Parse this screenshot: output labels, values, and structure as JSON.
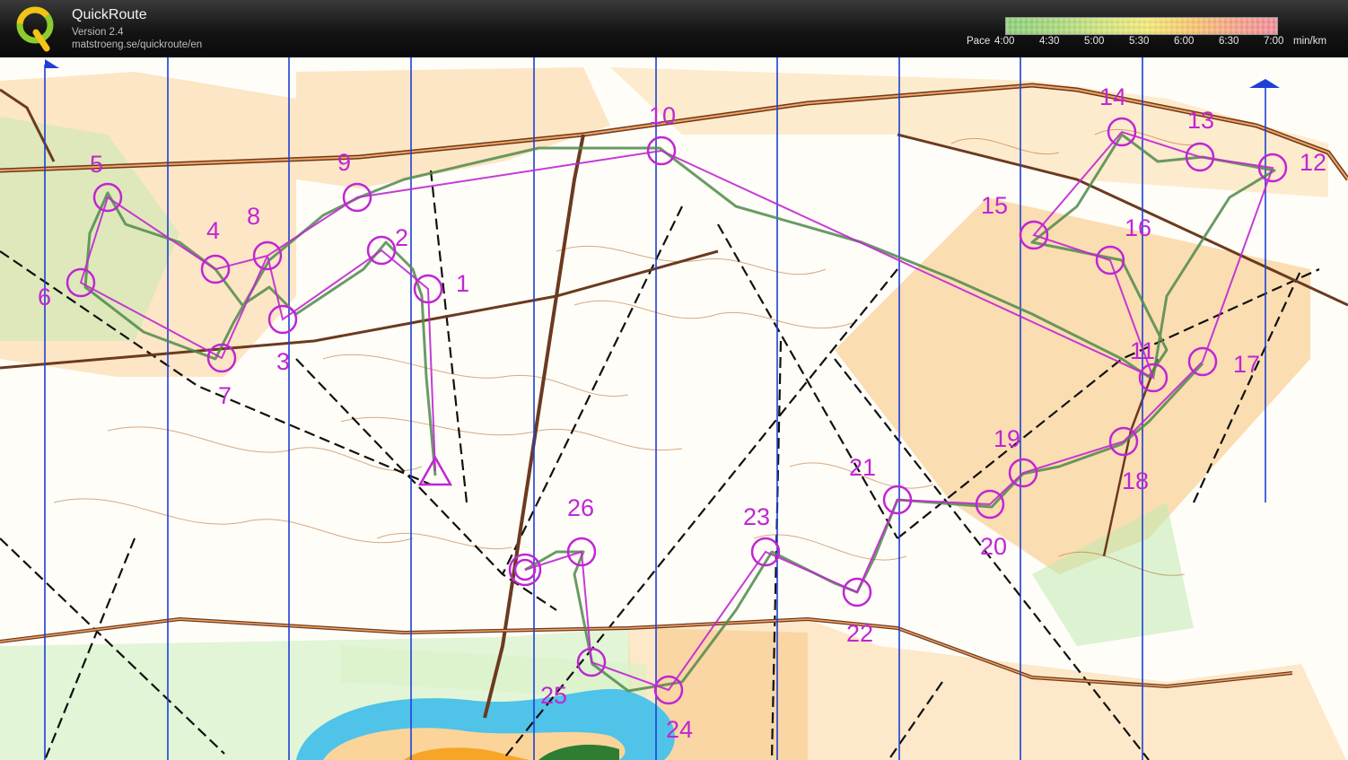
{
  "app": {
    "title": "QuickRoute",
    "version": "Version 2.4",
    "url": "matstroeng.se/quickroute/en"
  },
  "pace_legend": {
    "label": "Pace",
    "ticks": [
      "4:00",
      "4:30",
      "5:00",
      "5:30",
      "6:00",
      "6:30",
      "7:00"
    ],
    "unit": "min/km",
    "gradient_colors": [
      "#8fd07a",
      "#d3e680",
      "#f3ea7a",
      "#f8c96e",
      "#f48f9a"
    ]
  },
  "map": {
    "course_color": "#c026d3",
    "route_color": "#4f8a4b",
    "north_line_color": "#1e3fd8",
    "control_labels": [
      "1",
      "2",
      "3",
      "4",
      "5",
      "6",
      "7",
      "8",
      "9",
      "10",
      "11",
      "12",
      "13",
      "14",
      "15",
      "16",
      "17",
      "18",
      "19",
      "20",
      "21",
      "22",
      "23",
      "24",
      "25",
      "26"
    ]
  }
}
